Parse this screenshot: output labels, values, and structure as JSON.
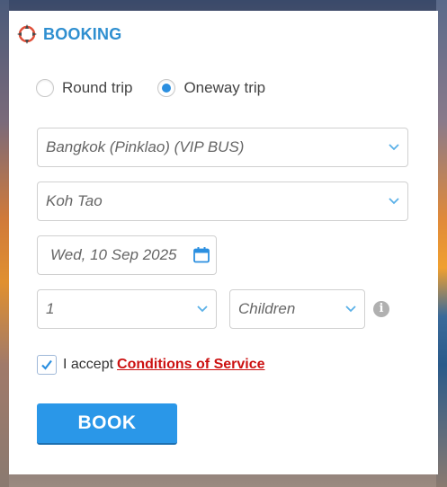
{
  "header": {
    "title": "BOOKING",
    "logo_icon": "compass-logo-icon"
  },
  "trip_type": {
    "options": [
      {
        "label": "Round trip",
        "checked": false
      },
      {
        "label": "Oneway trip",
        "checked": true
      }
    ]
  },
  "form": {
    "from": "Bangkok (Pinklao) (VIP BUS)",
    "to": "Koh Tao",
    "date": "Wed, 10 Sep 2025",
    "passenger_count": "1",
    "passenger_type": "Children",
    "info_glyph": "i"
  },
  "terms": {
    "checked": true,
    "prefix": "I accept",
    "link": "Conditions of Service"
  },
  "actions": {
    "book_label": "BOOK"
  },
  "colors": {
    "accent": "#2a97e8",
    "title": "#2f8fd0",
    "link": "#cc1111"
  }
}
